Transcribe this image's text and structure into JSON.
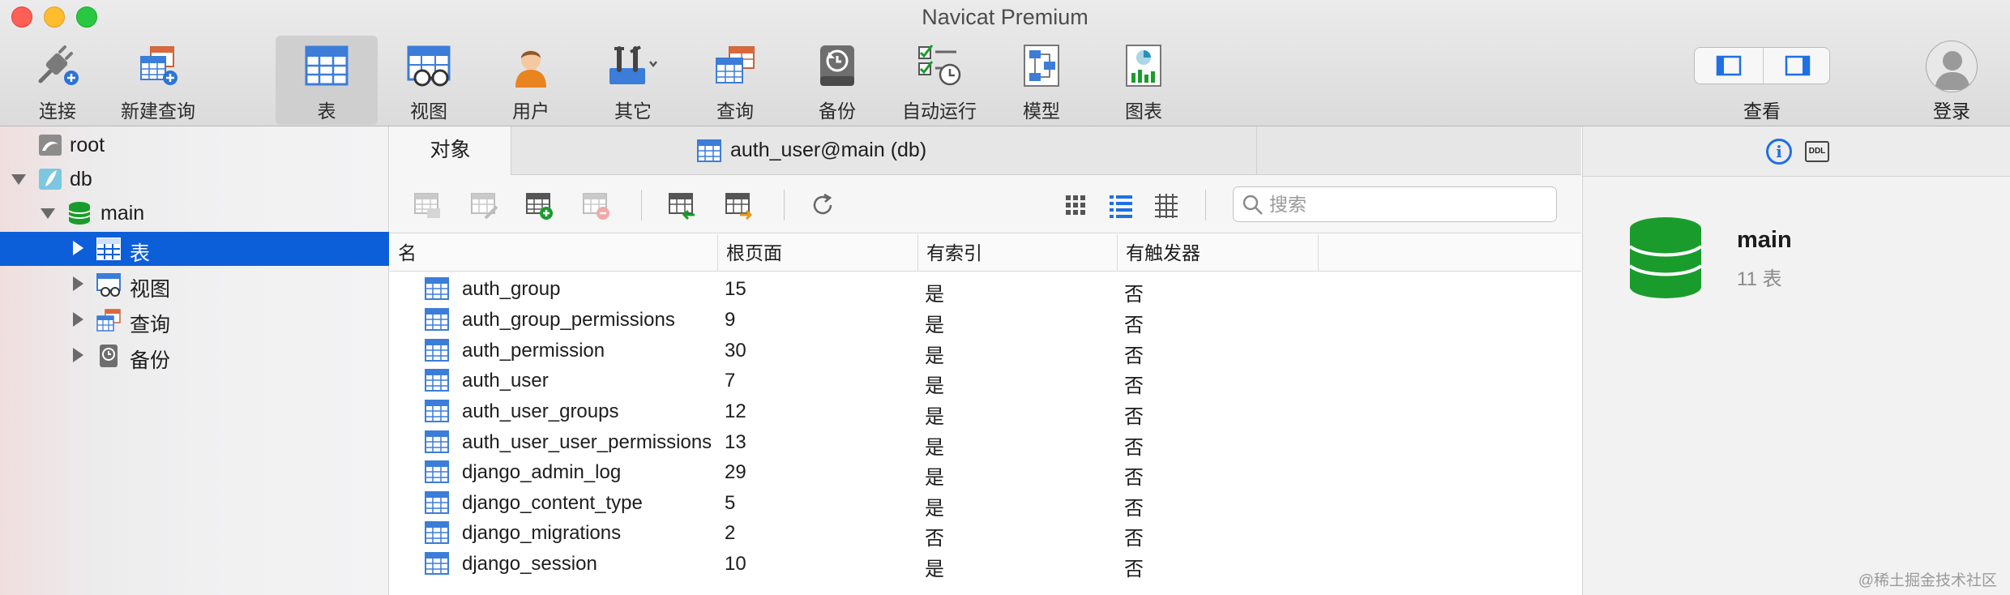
{
  "window": {
    "title": "Navicat Premium"
  },
  "toolbar": [
    {
      "id": "connect",
      "label": "连接",
      "icon": "plug-icon"
    },
    {
      "id": "new-query",
      "label": "新建查询",
      "icon": "new-query-icon"
    },
    {
      "id": "table",
      "label": "表",
      "icon": "table-icon",
      "active": true
    },
    {
      "id": "view",
      "label": "视图",
      "icon": "view-icon"
    },
    {
      "id": "user",
      "label": "用户",
      "icon": "user-icon"
    },
    {
      "id": "other",
      "label": "其它",
      "icon": "tools-icon"
    },
    {
      "id": "query",
      "label": "查询",
      "icon": "query-icon"
    },
    {
      "id": "backup",
      "label": "备份",
      "icon": "backup-icon"
    },
    {
      "id": "automation",
      "label": "自动运行",
      "icon": "checklist-icon"
    },
    {
      "id": "model",
      "label": "模型",
      "icon": "model-icon"
    },
    {
      "id": "chart",
      "label": "图表",
      "icon": "chart-icon"
    }
  ],
  "toolbar_right": {
    "view_label": "查看",
    "login_label": "登录"
  },
  "tree": [
    {
      "label": "root",
      "icon": "mysql-connection-icon"
    },
    {
      "label": "db",
      "icon": "sqlite-connection-icon",
      "expanded": true
    },
    {
      "label": "main",
      "icon": "database-icon",
      "expanded": true
    },
    {
      "label": "表",
      "icon": "table-icon",
      "selected": true
    },
    {
      "label": "视图",
      "icon": "view-icon"
    },
    {
      "label": "查询",
      "icon": "query-icon"
    },
    {
      "label": "备份",
      "icon": "backup-icon"
    }
  ],
  "tabs": {
    "objects": "对象",
    "document": "auth_user@main (db)"
  },
  "search": {
    "placeholder": "搜索"
  },
  "table": {
    "columns": [
      "名",
      "根页面",
      "有索引",
      "有触发器"
    ],
    "rows": [
      [
        "auth_group",
        "15",
        "是",
        "否"
      ],
      [
        "auth_group_permissions",
        "9",
        "是",
        "否"
      ],
      [
        "auth_permission",
        "30",
        "是",
        "否"
      ],
      [
        "auth_user",
        "7",
        "是",
        "否"
      ],
      [
        "auth_user_groups",
        "12",
        "是",
        "否"
      ],
      [
        "auth_user_user_permissions",
        "13",
        "是",
        "否"
      ],
      [
        "django_admin_log",
        "29",
        "是",
        "否"
      ],
      [
        "django_content_type",
        "5",
        "是",
        "否"
      ],
      [
        "django_migrations",
        "2",
        "否",
        "否"
      ],
      [
        "django_session",
        "10",
        "是",
        "否"
      ]
    ]
  },
  "info": {
    "name": "main",
    "subtitle": "11 表",
    "ddl_label": "DDL",
    "info_label": "i"
  },
  "watermark": "@稀土掘金技术社区",
  "colors": {
    "selection": "#0c5fd8",
    "table_icon_blue": "#3b7dd8",
    "db_green": "#1a9c2c",
    "accent_blue": "#1f6fe5"
  }
}
